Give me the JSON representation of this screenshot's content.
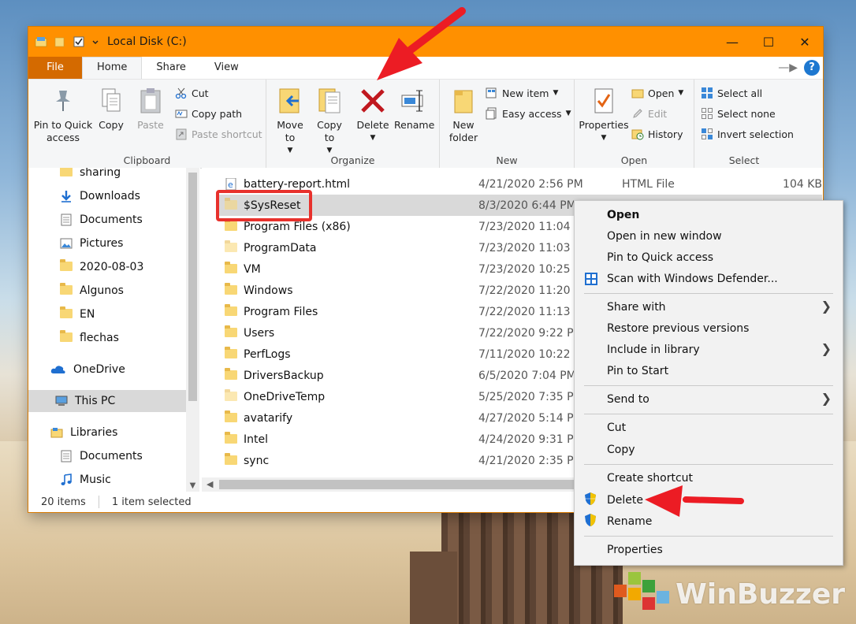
{
  "window": {
    "title": "Local Disk (C:)"
  },
  "ribbon_tabs": [
    "File",
    "Home",
    "Share",
    "View"
  ],
  "ribbon": {
    "clipboard": {
      "label": "Clipboard",
      "pin": "Pin to Quick access",
      "copy": "Copy",
      "paste": "Paste",
      "cut": "Cut",
      "copy_path": "Copy path",
      "paste_shortcut": "Paste shortcut"
    },
    "organize": {
      "label": "Organize",
      "move_to": "Move to",
      "copy_to": "Copy to",
      "delete": "Delete",
      "rename": "Rename"
    },
    "new": {
      "label": "New",
      "new_folder": "New folder",
      "new_item": "New item",
      "easy_access": "Easy access"
    },
    "open": {
      "label": "Open",
      "properties": "Properties",
      "open": "Open",
      "edit": "Edit",
      "history": "History"
    },
    "select": {
      "label": "Select",
      "select_all": "Select all",
      "select_none": "Select none",
      "invert": "Invert selection"
    }
  },
  "nav": [
    {
      "label": "sharing",
      "pinned": true
    },
    {
      "label": "Downloads",
      "pinned": true
    },
    {
      "label": "Documents",
      "pinned": true
    },
    {
      "label": "Pictures",
      "pinned": true
    },
    {
      "label": "2020-08-03",
      "pinned": false
    },
    {
      "label": "Algunos",
      "pinned": false
    },
    {
      "label": "EN",
      "pinned": false
    },
    {
      "label": "flechas",
      "pinned": false
    },
    {
      "label": "OneDrive",
      "pinned": false
    },
    {
      "label": "This PC",
      "pinned": false
    },
    {
      "label": "Libraries",
      "pinned": false
    },
    {
      "label": "Documents",
      "pinned": false
    },
    {
      "label": "Music",
      "pinned": false
    }
  ],
  "files": [
    {
      "name": "battery-report.html",
      "date": "4/21/2020 2:56 PM",
      "type": "HTML File",
      "size": "104 KB"
    },
    {
      "name": "$SysReset",
      "date": "8/3/2020 6:44 PM",
      "type": "",
      "size": ""
    },
    {
      "name": "Program Files (x86)",
      "date": "7/23/2020 11:04 A",
      "type": "",
      "size": ""
    },
    {
      "name": "ProgramData",
      "date": "7/23/2020 11:03 A",
      "type": "",
      "size": ""
    },
    {
      "name": "VM",
      "date": "7/23/2020 10:25 A",
      "type": "",
      "size": ""
    },
    {
      "name": "Windows",
      "date": "7/22/2020 11:20 P",
      "type": "",
      "size": ""
    },
    {
      "name": "Program Files",
      "date": "7/22/2020 11:13 P",
      "type": "",
      "size": ""
    },
    {
      "name": "Users",
      "date": "7/22/2020 9:22 PM",
      "type": "",
      "size": ""
    },
    {
      "name": "PerfLogs",
      "date": "7/11/2020 10:22 A",
      "type": "",
      "size": ""
    },
    {
      "name": "DriversBackup",
      "date": "6/5/2020 7:04 PM",
      "type": "",
      "size": ""
    },
    {
      "name": "OneDriveTemp",
      "date": "5/25/2020 7:35 PM",
      "type": "",
      "size": ""
    },
    {
      "name": "avatarify",
      "date": "4/27/2020 5:14 PM",
      "type": "",
      "size": ""
    },
    {
      "name": "Intel",
      "date": "4/24/2020 9:31 PM",
      "type": "",
      "size": ""
    },
    {
      "name": "sync",
      "date": "4/21/2020 2:35 PM",
      "type": "",
      "size": ""
    }
  ],
  "status": {
    "count": "20 items",
    "selected": "1 item selected"
  },
  "context_menu": {
    "open": "Open",
    "open_new_window": "Open in new window",
    "pin_quick_access": "Pin to Quick access",
    "scan_defender": "Scan with Windows Defender...",
    "share_with": "Share with",
    "restore_versions": "Restore previous versions",
    "include_library": "Include in library",
    "pin_start": "Pin to Start",
    "send_to": "Send to",
    "cut": "Cut",
    "copy": "Copy",
    "create_shortcut": "Create shortcut",
    "delete": "Delete",
    "rename": "Rename",
    "properties": "Properties"
  },
  "watermark": "WinBuzzer",
  "colors": {
    "titlebar": "#ff9000",
    "file_tab": "#d46a00",
    "highlight": "#e8312c",
    "selection": "#d9d9d9"
  }
}
